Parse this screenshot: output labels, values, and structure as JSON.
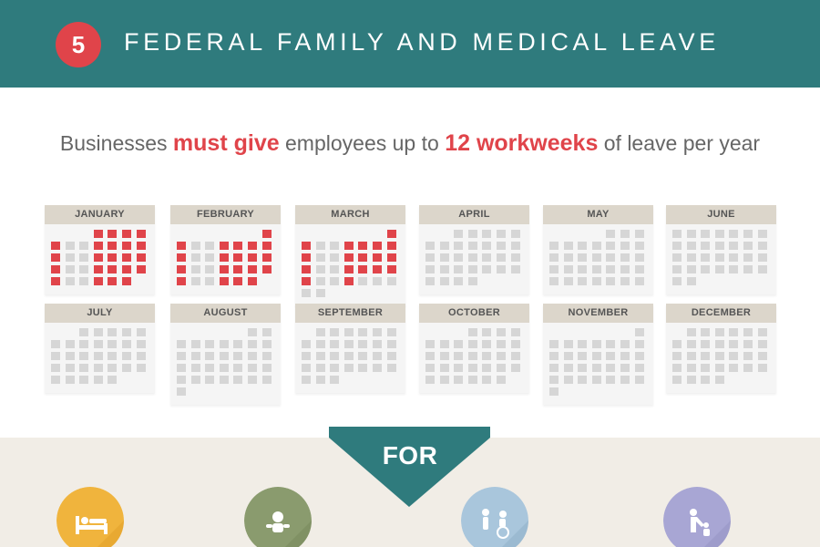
{
  "banner": {
    "number": "5",
    "title": "FEDERAL FAMILY AND MEDICAL LEAVE"
  },
  "headline": {
    "p1": "Businesses ",
    "em1": "must give",
    "p2": " employees up to ",
    "em2": "12 workweeks",
    "p3": " of leave per year"
  },
  "colors": {
    "banner": "#2f7b7d",
    "accent": "#e0444a",
    "calendar_header": "#dcd6cb",
    "day_cell": "#d6d6d6",
    "bottom_band": "#f1ede6"
  },
  "calendars": [
    {
      "month": "JANUARY",
      "start": 3,
      "days": 31,
      "leave_days": [
        1,
        2,
        3,
        4,
        5,
        8,
        9,
        10,
        11,
        12,
        15,
        16,
        17,
        18,
        19,
        22,
        23,
        24,
        25,
        26,
        29,
        30,
        31
      ]
    },
    {
      "month": "FEBRUARY",
      "start": 6,
      "days": 28,
      "leave_days": [
        1,
        2,
        5,
        6,
        7,
        8,
        9,
        12,
        13,
        14,
        15,
        16,
        19,
        20,
        21,
        22,
        23,
        26,
        27,
        28
      ]
    },
    {
      "month": "MARCH",
      "start": 6,
      "days": 31,
      "leave_days": [
        1,
        2,
        5,
        6,
        7,
        8,
        9,
        12,
        13,
        14,
        15,
        16,
        19,
        20,
        21,
        22,
        23,
        26
      ]
    },
    {
      "month": "APRIL",
      "start": 2,
      "days": 30,
      "leave_days": []
    },
    {
      "month": "MAY",
      "start": 4,
      "days": 31,
      "leave_days": []
    },
    {
      "month": "JUNE",
      "start": 0,
      "days": 30,
      "leave_days": []
    },
    {
      "month": "JULY",
      "start": 2,
      "days": 31,
      "leave_days": []
    },
    {
      "month": "AUGUST",
      "start": 5,
      "days": 31,
      "leave_days": []
    },
    {
      "month": "SEPTEMBER",
      "start": 1,
      "days": 30,
      "leave_days": []
    },
    {
      "month": "OCTOBER",
      "start": 3,
      "days": 31,
      "leave_days": []
    },
    {
      "month": "NOVEMBER",
      "start": 6,
      "days": 30,
      "leave_days": []
    },
    {
      "month": "DECEMBER",
      "start": 1,
      "days": 31,
      "leave_days": []
    }
  ],
  "for_label": "FOR",
  "reasons": [
    {
      "icon": "hospital-bed-icon",
      "color": "#f0b43d"
    },
    {
      "icon": "baby-icon",
      "color": "#8a9b6e"
    },
    {
      "icon": "caregiver-wheelchair-icon",
      "color": "#a9c6dc"
    },
    {
      "icon": "family-care-icon",
      "color": "#a8a6d4"
    }
  ]
}
